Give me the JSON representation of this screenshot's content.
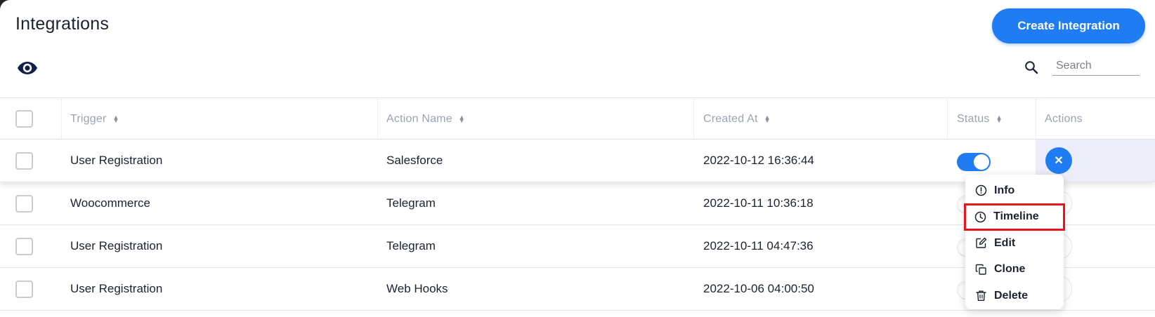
{
  "header": {
    "title": "Integrations",
    "create_label": "Create Integration",
    "search_placeholder": "Search"
  },
  "table": {
    "columns": [
      "Trigger",
      "Action Name",
      "Created At",
      "Status",
      "Actions"
    ],
    "rows": [
      {
        "trigger": "User Registration",
        "action": "Salesforce",
        "created": "2022-10-12 16:36:44",
        "status": true
      },
      {
        "trigger": "Woocommerce",
        "action": "Telegram",
        "created": "2022-10-11 10:36:18",
        "status": true
      },
      {
        "trigger": "User Registration",
        "action": "Telegram",
        "created": "2022-10-11 04:47:36",
        "status": true
      },
      {
        "trigger": "User Registration",
        "action": "Web Hooks",
        "created": "2022-10-06 04:00:50",
        "status": true
      }
    ]
  },
  "menu": {
    "items": [
      "Info",
      "Timeline",
      "Edit",
      "Clone",
      "Delete"
    ],
    "highlighted": "Timeline"
  },
  "colors": {
    "accent": "#1f7cf2",
    "highlight_border": "#e8141c",
    "active_actions_bg": "#ededf9"
  }
}
